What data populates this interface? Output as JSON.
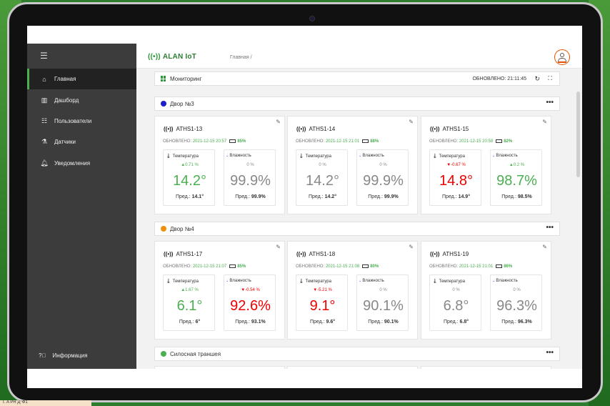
{
  "app": {
    "brand": "ALAN IoT",
    "breadcrumb": "Главная /"
  },
  "sidebar": {
    "items": [
      {
        "label": "Главная",
        "icon": "home-icon"
      },
      {
        "label": "Дашборд",
        "icon": "chart-icon"
      },
      {
        "label": "Пользователи",
        "icon": "users-icon"
      },
      {
        "label": "Датчики",
        "icon": "sensor-icon"
      },
      {
        "label": "Уведомления",
        "icon": "bell-icon"
      }
    ],
    "info_label": "Информация"
  },
  "monitoring": {
    "title": "Мониторинг",
    "updated": "ОБНОВЛЕНО: 21:11:45"
  },
  "groups": [
    {
      "name": "Двор №3",
      "color": "#1e1ecc"
    },
    {
      "name": "Двор №4",
      "color": "#f0900a"
    },
    {
      "name": "Силосная траншея",
      "color": "#4caf50"
    }
  ],
  "labels": {
    "updated_prefix": "ОБНОВЛЕНО:",
    "temp": "Температура",
    "hum": "Влажность",
    "prev": "Пред.:",
    "more": "•••"
  },
  "cards": [
    {
      "name": "ATHS1-13",
      "date": "2021-12-15 20:57",
      "battery": "85%",
      "t_delta": "▲0.71 %",
      "t_val": "14.2°",
      "t_prev": "14.1°",
      "h_delta": "0 %",
      "h_val": "99.9%",
      "h_prev": "99.9%"
    },
    {
      "name": "ATHS1-14",
      "date": "2021-12-15 21:01",
      "battery": "88%",
      "t_delta": "0 %",
      "t_val": "14.2°",
      "t_prev": "14.2°",
      "h_delta": "0 %",
      "h_val": "99.9%",
      "h_prev": "99.9%"
    },
    {
      "name": "ATHS1-15",
      "date": "2021-12-15 20:58",
      "battery": "82%",
      "t_delta": "▼-0.67 %",
      "t_val": "14.8°",
      "t_prev": "14.9°",
      "h_delta": "▲0.2 %",
      "h_val": "98.7%",
      "h_prev": "98.5%"
    },
    {
      "name": "ATHS1-17",
      "date": "2021-12-15 21:07",
      "battery": "85%",
      "t_delta": "▲1.67 %",
      "t_val": "6.1°",
      "t_prev": "6°",
      "h_delta": "▼-0.54 %",
      "h_val": "92.6%",
      "h_prev": "93.1%"
    },
    {
      "name": "ATHS1-18",
      "date": "2021-12-15 21:08",
      "battery": "80%",
      "t_delta": "▼-5.21 %",
      "t_val": "9.1°",
      "t_prev": "9.6°",
      "h_delta": "0 %",
      "h_val": "90.1%",
      "h_prev": "90.1%"
    },
    {
      "name": "ATHS1-19",
      "date": "2021-12-15 21:01",
      "battery": "86%",
      "t_delta": "0 %",
      "t_val": "6.8°",
      "t_prev": "6.8°",
      "h_delta": "0 %",
      "h_val": "96.3%",
      "h_prev": "96.3%"
    }
  ],
  "taskbar": {
    "text": "T. A PR Д°Ф1"
  },
  "colors": {
    "accent": "#4caf50",
    "negative": "#e00000",
    "sidebar": "#3c3c3c"
  }
}
